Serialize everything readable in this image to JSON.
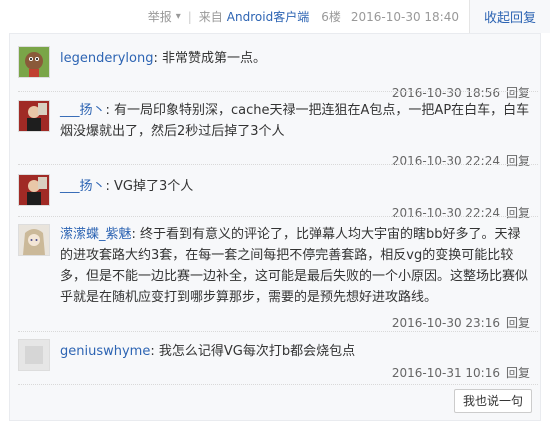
{
  "topbar": {
    "report": "举报",
    "report_caret": "▾",
    "from_prefix": "来自",
    "client": "Android客户端",
    "floor": "6楼",
    "datetime": "2016-10-30 18:40",
    "collapse_label": "收起回复"
  },
  "replies": [
    {
      "user": "legenderylong",
      "text": "非常赞成第一点。",
      "time": "2016-10-30 18:56",
      "reply_label": "回复",
      "avatar_color": "#6b8f3a"
    },
    {
      "user": "___扬丶",
      "text": "有一局印象特别深，cache天禄一把连狙在A包点，一把AP在白车，白车烟没爆就出了，然后2秒过后掉了3个人",
      "time": "2016-10-30 22:24",
      "reply_label": "回复",
      "avatar_color": "#b5322c"
    },
    {
      "user": "___扬丶",
      "text": "VG掉了3个人",
      "time": "2016-10-30 22:24",
      "reply_label": "回复",
      "avatar_color": "#b5322c"
    },
    {
      "user": "潆潆蝶_紫魅",
      "text": "终于看到有意义的评论了，比弹幕人均大宇宙的瞎bb好多了。天禄的进攻套路大约3套，在每一套之间每把不停完善套路，相反vg的变换可能比较多，但是不能一边比赛一边补全，这可能是最后失败的一个小原因。这整场比赛似乎就是在随机应变打到哪步算那步，需要的是预先想好进攻路线。",
      "time": "2016-10-30 23:16",
      "reply_label": "回复",
      "avatar_color": "#c9b9a0"
    },
    {
      "user": "geniuswhyme",
      "text": "我怎么记得VG每次打b都会烧包点",
      "time": "2016-10-31 10:16",
      "reply_label": "回复",
      "avatar_color": "#dcdcdc"
    }
  ],
  "say_button": "我也说一句"
}
